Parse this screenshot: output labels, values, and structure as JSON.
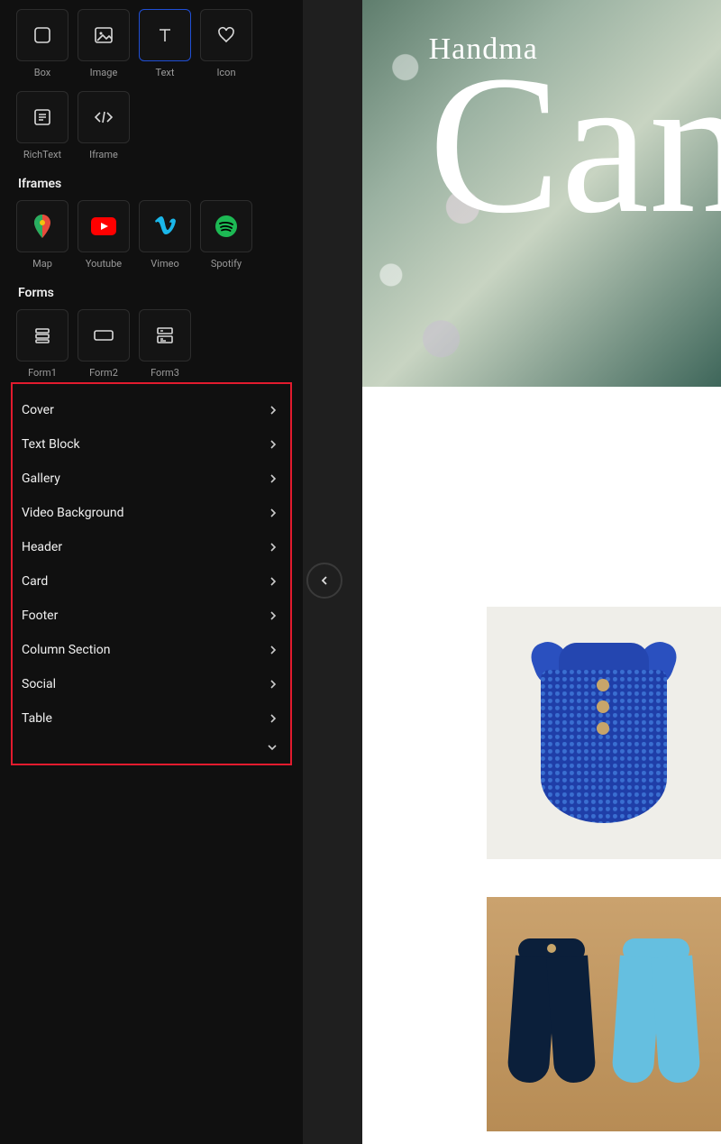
{
  "elements_row1": [
    {
      "key": "box",
      "label": "Box"
    },
    {
      "key": "image",
      "label": "Image"
    },
    {
      "key": "text",
      "label": "Text",
      "selected": true
    },
    {
      "key": "icon",
      "label": "Icon"
    }
  ],
  "elements_row2": [
    {
      "key": "richtext",
      "label": "RichText"
    },
    {
      "key": "iframe",
      "label": "Iframe"
    }
  ],
  "sections": {
    "iframes_title": "Iframes",
    "forms_title": "Forms"
  },
  "iframes": [
    {
      "key": "map",
      "label": "Map"
    },
    {
      "key": "youtube",
      "label": "Youtube"
    },
    {
      "key": "vimeo",
      "label": "Vimeo"
    },
    {
      "key": "spotify",
      "label": "Spotify"
    }
  ],
  "forms": [
    {
      "key": "form1",
      "label": "Form1"
    },
    {
      "key": "form2",
      "label": "Form2"
    },
    {
      "key": "form3",
      "label": "Form3"
    }
  ],
  "templates": [
    "Cover",
    "Text Block",
    "Gallery",
    "Video Background",
    "Header",
    "Card",
    "Footer",
    "Column Section",
    "Social",
    "Table"
  ],
  "hero": {
    "subtitle": "Handma",
    "script": "Can"
  }
}
